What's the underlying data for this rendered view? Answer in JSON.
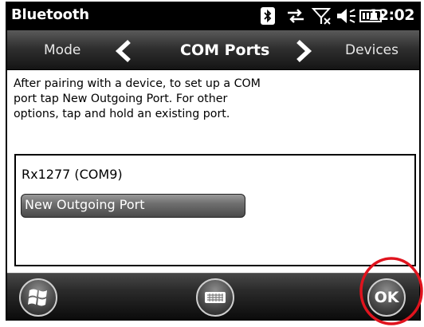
{
  "status_bar": {
    "title": "Bluetooth",
    "time": "12:02",
    "icons": [
      "bluetooth-icon",
      "data-connection-icon",
      "no-signal-icon",
      "volume-icon",
      "battery-icon"
    ]
  },
  "header": {
    "prev_tab": "Mode",
    "current_tab": "COM Ports",
    "next_tab": "Devices"
  },
  "instructions": [
    "After pairing with a device, to set up a COM",
    "port tap New Outgoing Port. For other",
    "options, tap and hold an existing port."
  ],
  "port_list": {
    "items": [
      "Rx1277 (COM9)"
    ],
    "new_port_label": "New Outgoing Port"
  },
  "bottom_bar": {
    "ok_label": "OK",
    "icons": [
      "windows-start-icon",
      "keyboard-icon"
    ]
  },
  "colors": {
    "annotation": "#e0141e",
    "status_bar": "#000000",
    "button_border": "#cfcfcf"
  }
}
